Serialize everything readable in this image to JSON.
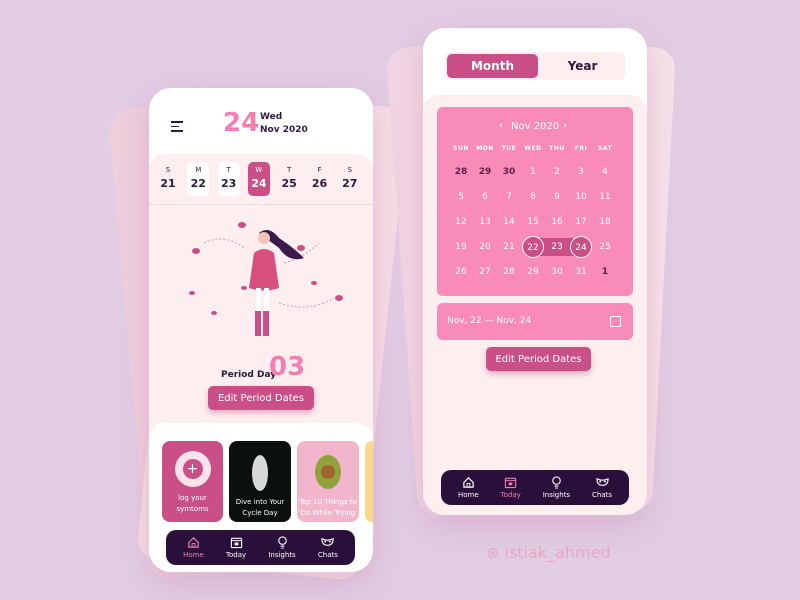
{
  "left": {
    "header": {
      "day_number": "24",
      "weekday": "Wed",
      "month_year": "Nov 2020"
    },
    "week": [
      {
        "letter": "S",
        "date": "21"
      },
      {
        "letter": "M",
        "date": "22"
      },
      {
        "letter": "T",
        "date": "23"
      },
      {
        "letter": "W",
        "date": "24",
        "selected": true
      },
      {
        "letter": "T",
        "date": "25"
      },
      {
        "letter": "F",
        "date": "26"
      },
      {
        "letter": "S",
        "date": "27"
      }
    ],
    "period_label": "Period Day",
    "period_number": "03",
    "edit_button": "Edit Period Dates",
    "cards": [
      {
        "line1": "log your",
        "line2": "symtoms"
      },
      {
        "line1": "Dive into Your",
        "line2": "Cycle Day"
      },
      {
        "line1": "Top 10 Things to",
        "line2": "Do While Trying"
      }
    ],
    "nav": [
      {
        "label": "Home",
        "icon": "home-icon"
      },
      {
        "label": "Today",
        "icon": "calendar-icon"
      },
      {
        "label": "Insights",
        "icon": "lightbulb-icon"
      },
      {
        "label": "Chats",
        "icon": "mask-icon"
      }
    ],
    "nav_active": "Home"
  },
  "right": {
    "toggle": {
      "month": "Month",
      "year": "Year",
      "active": "Month"
    },
    "calendar": {
      "title": "Nov 2020",
      "weekdays": [
        "SUN",
        "MON",
        "TUE",
        "WED",
        "THU",
        "FRI",
        "SAT"
      ],
      "weeks": [
        [
          "28",
          "29",
          "30",
          "1",
          "2",
          "3",
          "4"
        ],
        [
          "5",
          "6",
          "7",
          "8",
          "9",
          "10",
          "11"
        ],
        [
          "12",
          "13",
          "14",
          "15",
          "16",
          "17",
          "18"
        ],
        [
          "19",
          "20",
          "21",
          "22",
          "23",
          "24",
          "25"
        ],
        [
          "26",
          "27",
          "28",
          "29",
          "30",
          "31",
          "1"
        ]
      ],
      "range_start": "22",
      "range_end": "24"
    },
    "range_field": "Nov, 22 — Nov, 24",
    "edit_button": "Edit Period Dates",
    "nav": [
      {
        "label": "Home",
        "icon": "home-icon"
      },
      {
        "label": "Today",
        "icon": "calendar-icon"
      },
      {
        "label": "Insights",
        "icon": "lightbulb-icon"
      },
      {
        "label": "Chats",
        "icon": "mask-icon"
      }
    ],
    "nav_active": "Today"
  },
  "watermark": "istiak_ahmed",
  "colors": {
    "accent": "#c94f86",
    "pink": "#f98bb8",
    "nav": "#2b0f3b",
    "light": "#fdeef0"
  }
}
